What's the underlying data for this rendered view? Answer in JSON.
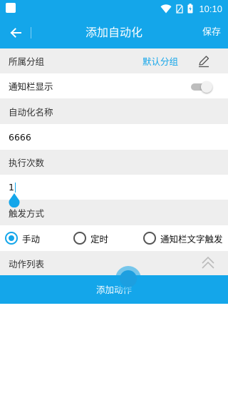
{
  "status_bar": {
    "time": "10:10",
    "icons": [
      "wifi-icon",
      "sim-card-icon",
      "battery-charging-icon"
    ]
  },
  "app_bar": {
    "title": "添加自动化",
    "save_label": "保存",
    "back_icon": "arrow-left-icon"
  },
  "group": {
    "label": "所属分组",
    "value": "默认分组",
    "edit_icon": "pencil-icon"
  },
  "notification_display": {
    "label": "通知栏显示",
    "enabled": false
  },
  "automation_name": {
    "label": "自动化名称",
    "value": "6666"
  },
  "execution_count": {
    "label": "执行次数",
    "value": "1"
  },
  "trigger": {
    "label": "触发方式",
    "options": [
      {
        "label": "手动",
        "selected": true
      },
      {
        "label": "定时",
        "selected": false
      },
      {
        "label": "通知栏文字触发",
        "selected": false
      }
    ]
  },
  "action_list": {
    "label": "动作列表",
    "collapse_icon": "double-chevron-up-icon"
  },
  "add_action": {
    "label": "添加动作"
  },
  "colors": {
    "accent": "#14a6ea",
    "section_bg": "#eeeeee"
  }
}
